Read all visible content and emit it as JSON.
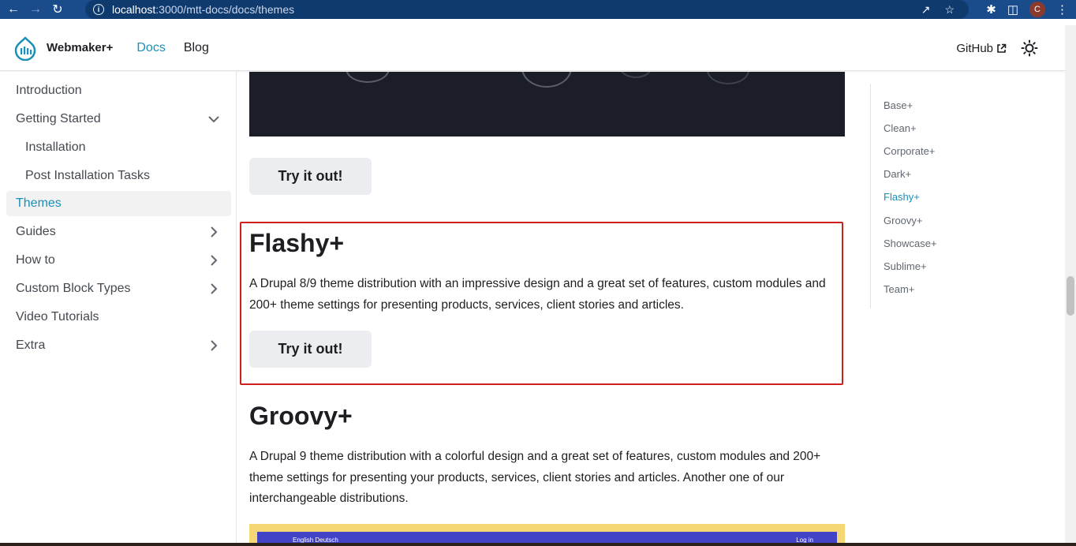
{
  "browser": {
    "url_host": "localhost",
    "url_path": ":3000/mtt-docs/docs/themes",
    "avatar_letter": "C"
  },
  "navbar": {
    "brand": "Webmaker+",
    "links": [
      "Docs",
      "Blog"
    ],
    "github": "GitHub"
  },
  "sidebar": {
    "items": [
      {
        "label": "Introduction"
      },
      {
        "label": "Getting Started"
      },
      {
        "label": "Installation"
      },
      {
        "label": "Post Installation Tasks"
      },
      {
        "label": "Themes"
      },
      {
        "label": "Guides"
      },
      {
        "label": "How to"
      },
      {
        "label": "Custom Block Types"
      },
      {
        "label": "Video Tutorials"
      },
      {
        "label": "Extra"
      }
    ]
  },
  "main": {
    "try_button": "Try it out!",
    "sections": [
      {
        "title": "Flashy+",
        "description": "A Drupal 8/9 theme distribution with an impressive design and a great set of features, custom modules and 200+ theme settings for presenting products, services, client stories and articles."
      },
      {
        "title": "Groovy+",
        "description": "A Drupal 9 theme distribution with a colorful design and a great set of features, custom modules and 200+ theme settings for presenting your products, services, client stories and articles. Another one of our interchangeable distributions."
      }
    ],
    "preview_left": "English   Deutsch",
    "preview_right": "Log in"
  },
  "toc": {
    "items": [
      "Base+",
      "Clean+",
      "Corporate+",
      "Dark+",
      "Flashy+",
      "Groovy+",
      "Showcase+",
      "Sublime+",
      "Team+"
    ],
    "active": "Flashy+"
  },
  "colors": {
    "accent": "#1a8fb8",
    "highlight_border": "#d0201c",
    "chrome_bar": "#1a4c8c"
  }
}
